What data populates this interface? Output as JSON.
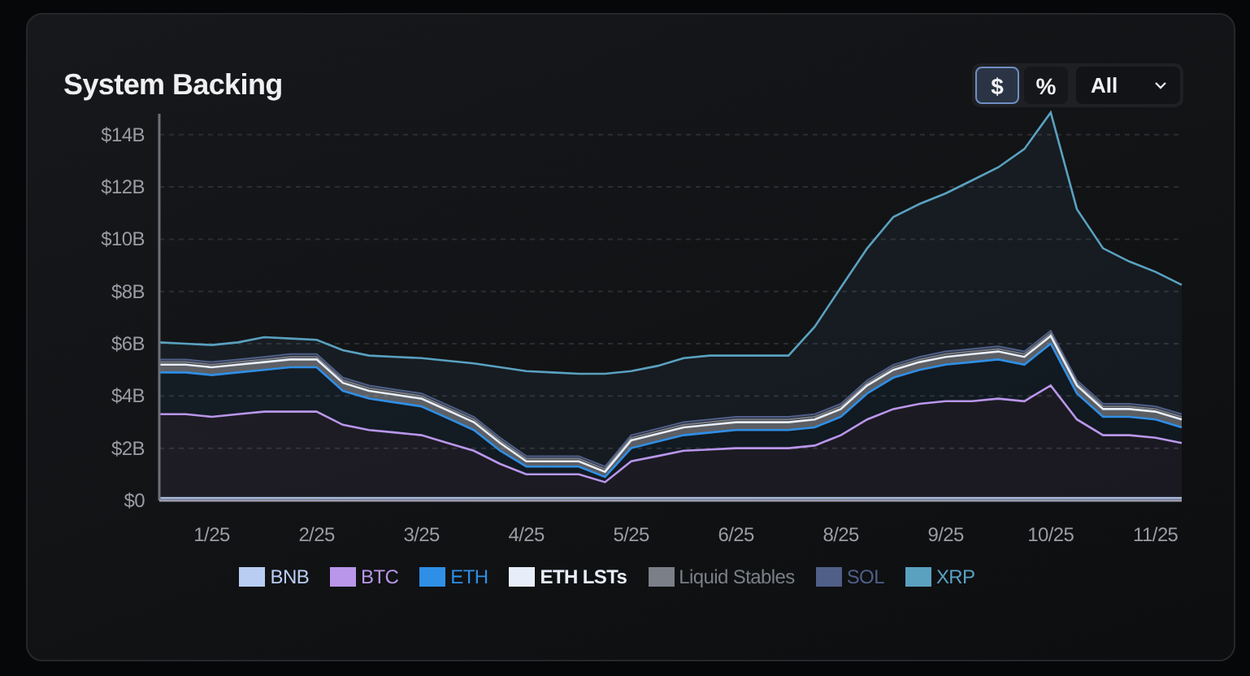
{
  "card": {
    "title": "System Backing",
    "unit_toggle": [
      {
        "label": "$",
        "selected": true
      },
      {
        "label": "%",
        "selected": false
      }
    ],
    "range_select": {
      "value": "All"
    },
    "chart_data": {
      "type": "area",
      "stacked": true,
      "grid": true,
      "categories": [
        null,
        null,
        "1/25",
        null,
        null,
        null,
        "2/25",
        null,
        null,
        null,
        "3/25",
        null,
        null,
        null,
        "4/25",
        null,
        null,
        null,
        "5/25",
        null,
        null,
        null,
        "6/25",
        null,
        null,
        null,
        "8/25",
        null,
        null,
        null,
        "9/25",
        null,
        null,
        null,
        "10/25",
        null,
        null,
        null,
        "11/25",
        null
      ],
      "ylim": [
        0,
        14.8
      ],
      "yticks": [
        {
          "value": 0,
          "label": "$0"
        },
        {
          "value": 2,
          "label": "$2B"
        },
        {
          "value": 4,
          "label": "$4B"
        },
        {
          "value": 6,
          "label": "$6B"
        },
        {
          "value": 8,
          "label": "$8B"
        },
        {
          "value": 10,
          "label": "$10B"
        },
        {
          "value": 12,
          "label": "$12B"
        },
        {
          "value": 14,
          "label": "$14B"
        }
      ],
      "series": [
        {
          "name": "BNB",
          "color": "#b9cdf3",
          "values": [
            0.1,
            0.1,
            0.1,
            0.1,
            0.1,
            0.1,
            0.1,
            0.1,
            0.1,
            0.1,
            0.1,
            0.1,
            0.1,
            0.1,
            0.1,
            0.1,
            0.1,
            0.1,
            0.1,
            0.1,
            0.1,
            0.1,
            0.1,
            0.1,
            0.1,
            0.1,
            0.1,
            0.1,
            0.1,
            0.1,
            0.1,
            0.1,
            0.1,
            0.1,
            0.1,
            0.1,
            0.1,
            0.1,
            0.1,
            0.1
          ]
        },
        {
          "name": "BTC",
          "color": "#b996ea",
          "values": [
            3.2,
            3.2,
            3.1,
            3.2,
            3.3,
            3.3,
            3.3,
            2.8,
            2.6,
            2.5,
            2.4,
            2.1,
            1.8,
            1.3,
            0.9,
            0.9,
            0.9,
            0.6,
            1.4,
            1.6,
            1.8,
            1.85,
            1.9,
            1.9,
            1.9,
            2.0,
            2.4,
            3.0,
            3.4,
            3.6,
            3.7,
            3.7,
            3.8,
            3.7,
            4.3,
            3.0,
            2.4,
            2.4,
            2.3,
            2.1
          ]
        },
        {
          "name": "ETH",
          "color": "#2f8fe6",
          "values": [
            1.6,
            1.6,
            1.6,
            1.6,
            1.6,
            1.7,
            1.7,
            1.3,
            1.2,
            1.15,
            1.1,
            0.95,
            0.8,
            0.5,
            0.3,
            0.3,
            0.3,
            0.2,
            0.5,
            0.55,
            0.6,
            0.65,
            0.7,
            0.7,
            0.7,
            0.7,
            0.7,
            1.0,
            1.2,
            1.3,
            1.4,
            1.5,
            1.5,
            1.4,
            1.6,
            1.0,
            0.7,
            0.7,
            0.7,
            0.6
          ]
        },
        {
          "name": "ETH LSTs",
          "color": "#e8eef9",
          "values": [
            0.3,
            0.3,
            0.3,
            0.3,
            0.3,
            0.3,
            0.3,
            0.3,
            0.3,
            0.3,
            0.3,
            0.3,
            0.3,
            0.3,
            0.2,
            0.2,
            0.2,
            0.2,
            0.3,
            0.3,
            0.3,
            0.3,
            0.3,
            0.3,
            0.3,
            0.3,
            0.3,
            0.3,
            0.3,
            0.3,
            0.3,
            0.3,
            0.3,
            0.3,
            0.3,
            0.3,
            0.3,
            0.3,
            0.3,
            0.3
          ]
        },
        {
          "name": "Liquid Stables",
          "color": "#7b7f87",
          "values": [
            0.1,
            0.1,
            0.1,
            0.1,
            0.1,
            0.1,
            0.1,
            0.1,
            0.1,
            0.1,
            0.1,
            0.1,
            0.1,
            0.1,
            0.1,
            0.1,
            0.1,
            0.1,
            0.1,
            0.1,
            0.1,
            0.1,
            0.1,
            0.1,
            0.1,
            0.1,
            0.1,
            0.1,
            0.1,
            0.1,
            0.1,
            0.1,
            0.1,
            0.1,
            0.1,
            0.1,
            0.1,
            0.1,
            0.1,
            0.1
          ]
        },
        {
          "name": "SOL",
          "color": "#4f5f88",
          "values": [
            0.1,
            0.1,
            0.1,
            0.1,
            0.1,
            0.1,
            0.1,
            0.1,
            0.1,
            0.1,
            0.1,
            0.1,
            0.1,
            0.1,
            0.1,
            0.1,
            0.1,
            0.1,
            0.1,
            0.1,
            0.1,
            0.1,
            0.1,
            0.1,
            0.1,
            0.1,
            0.1,
            0.1,
            0.1,
            0.1,
            0.1,
            0.1,
            0.1,
            0.1,
            0.1,
            0.1,
            0.1,
            0.1,
            0.1,
            0.1
          ]
        },
        {
          "name": "XRP",
          "color": "#5aa1c0",
          "values": [
            0.65,
            0.6,
            0.65,
            0.65,
            0.75,
            0.6,
            0.55,
            1.05,
            1.15,
            1.25,
            1.35,
            1.7,
            2.05,
            2.7,
            3.25,
            3.2,
            3.15,
            3.55,
            2.45,
            2.4,
            2.45,
            2.45,
            2.35,
            2.35,
            2.35,
            3.35,
            4.45,
            5.05,
            5.65,
            5.85,
            6.05,
            6.45,
            6.85,
            7.75,
            8.35,
            6.55,
            5.95,
            5.45,
            5.15,
            4.95
          ]
        }
      ]
    }
  }
}
